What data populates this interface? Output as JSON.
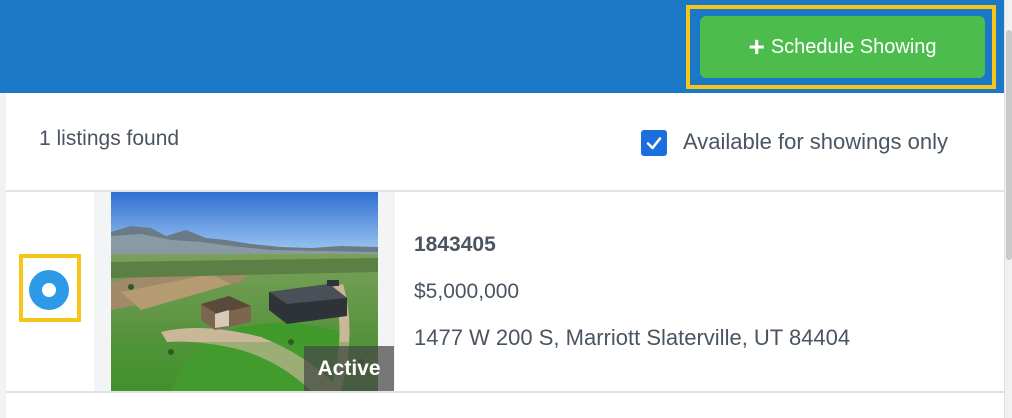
{
  "header": {
    "schedule_button_label": "Schedule Showing",
    "schedule_button_icon": "plus-icon",
    "bar_color": "#1a78c6",
    "button_color": "#4cbd4c"
  },
  "results": {
    "count_text": "1 listings found",
    "filter_label": "Available for showings only",
    "filter_checked": true
  },
  "listings": [
    {
      "selected": true,
      "mls_number": "1843405",
      "price": "$5,000,000",
      "address": "1477 W 200 S, Marriott Slaterville, UT 84404",
      "status": "Active",
      "photo_description": "aerial-property-photo"
    }
  ],
  "highlight_color": "#f5c518"
}
